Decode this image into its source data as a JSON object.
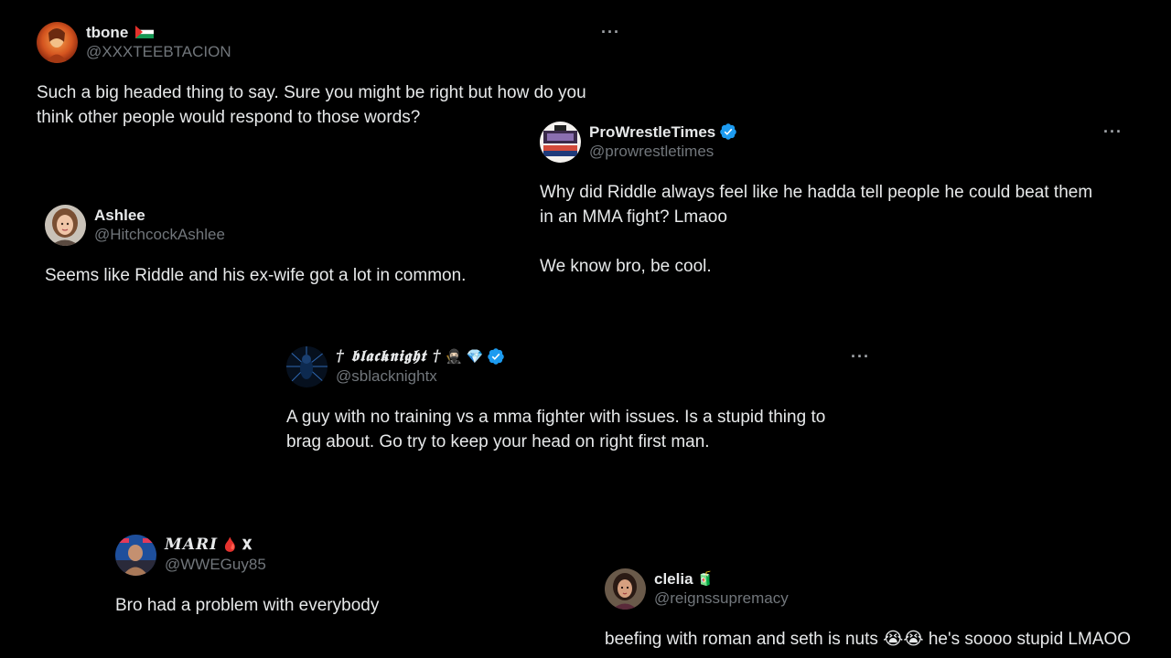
{
  "colors": {
    "background": "#000000",
    "text": "#e7e9ea",
    "handle": "#71767b",
    "verified": "#1d9bf0"
  },
  "tweets": [
    {
      "display_name": "tbone",
      "name_emoji": "palestine-flag",
      "handle": "@XXXTEEBTACION",
      "text": "Such a big headed thing to say. Sure you might be right but how do you\nthink other people would respond to those words?",
      "more_icon": "more-horizontal-icon"
    },
    {
      "display_name": "ProWrestleTimes",
      "verified": true,
      "handle": "@prowrestletimes",
      "text": "Why did Riddle always feel like he hadda tell people he could beat them\nin an MMA fight? Lmaoo\n\nWe know bro, be cool.",
      "more_icon": "more-horizontal-icon"
    },
    {
      "display_name": "Ashlee",
      "handle": "@HitchcockAshlee",
      "text": "Seems like Riddle and his ex-wife got a lot in common."
    },
    {
      "display_name": "† 𝖇𝖑𝖆𝖈𝖐𝖓𝖎𝖌𝖍𝖙 †",
      "name_emoji": "🥷🏻 💎",
      "verified": true,
      "handle": "@sblacknightx",
      "text": "A guy with no training vs a mma fighter with issues. Is a stupid thing to\nbrag about. Go try to keep your head on right first man.",
      "more_icon": "more-horizontal-icon"
    },
    {
      "display_name": "𝑴𝑨𝑹𝑰",
      "name_emoji": "🩸 𝐗",
      "handle": "@WWEGuy85",
      "text": "Bro had a problem with everybody"
    },
    {
      "display_name": "clelia",
      "name_emoji": "🧃",
      "handle": "@reignssupremacy",
      "text": "beefing with roman and seth is nuts 😭😭 he's soooo stupid LMAOO"
    }
  ]
}
